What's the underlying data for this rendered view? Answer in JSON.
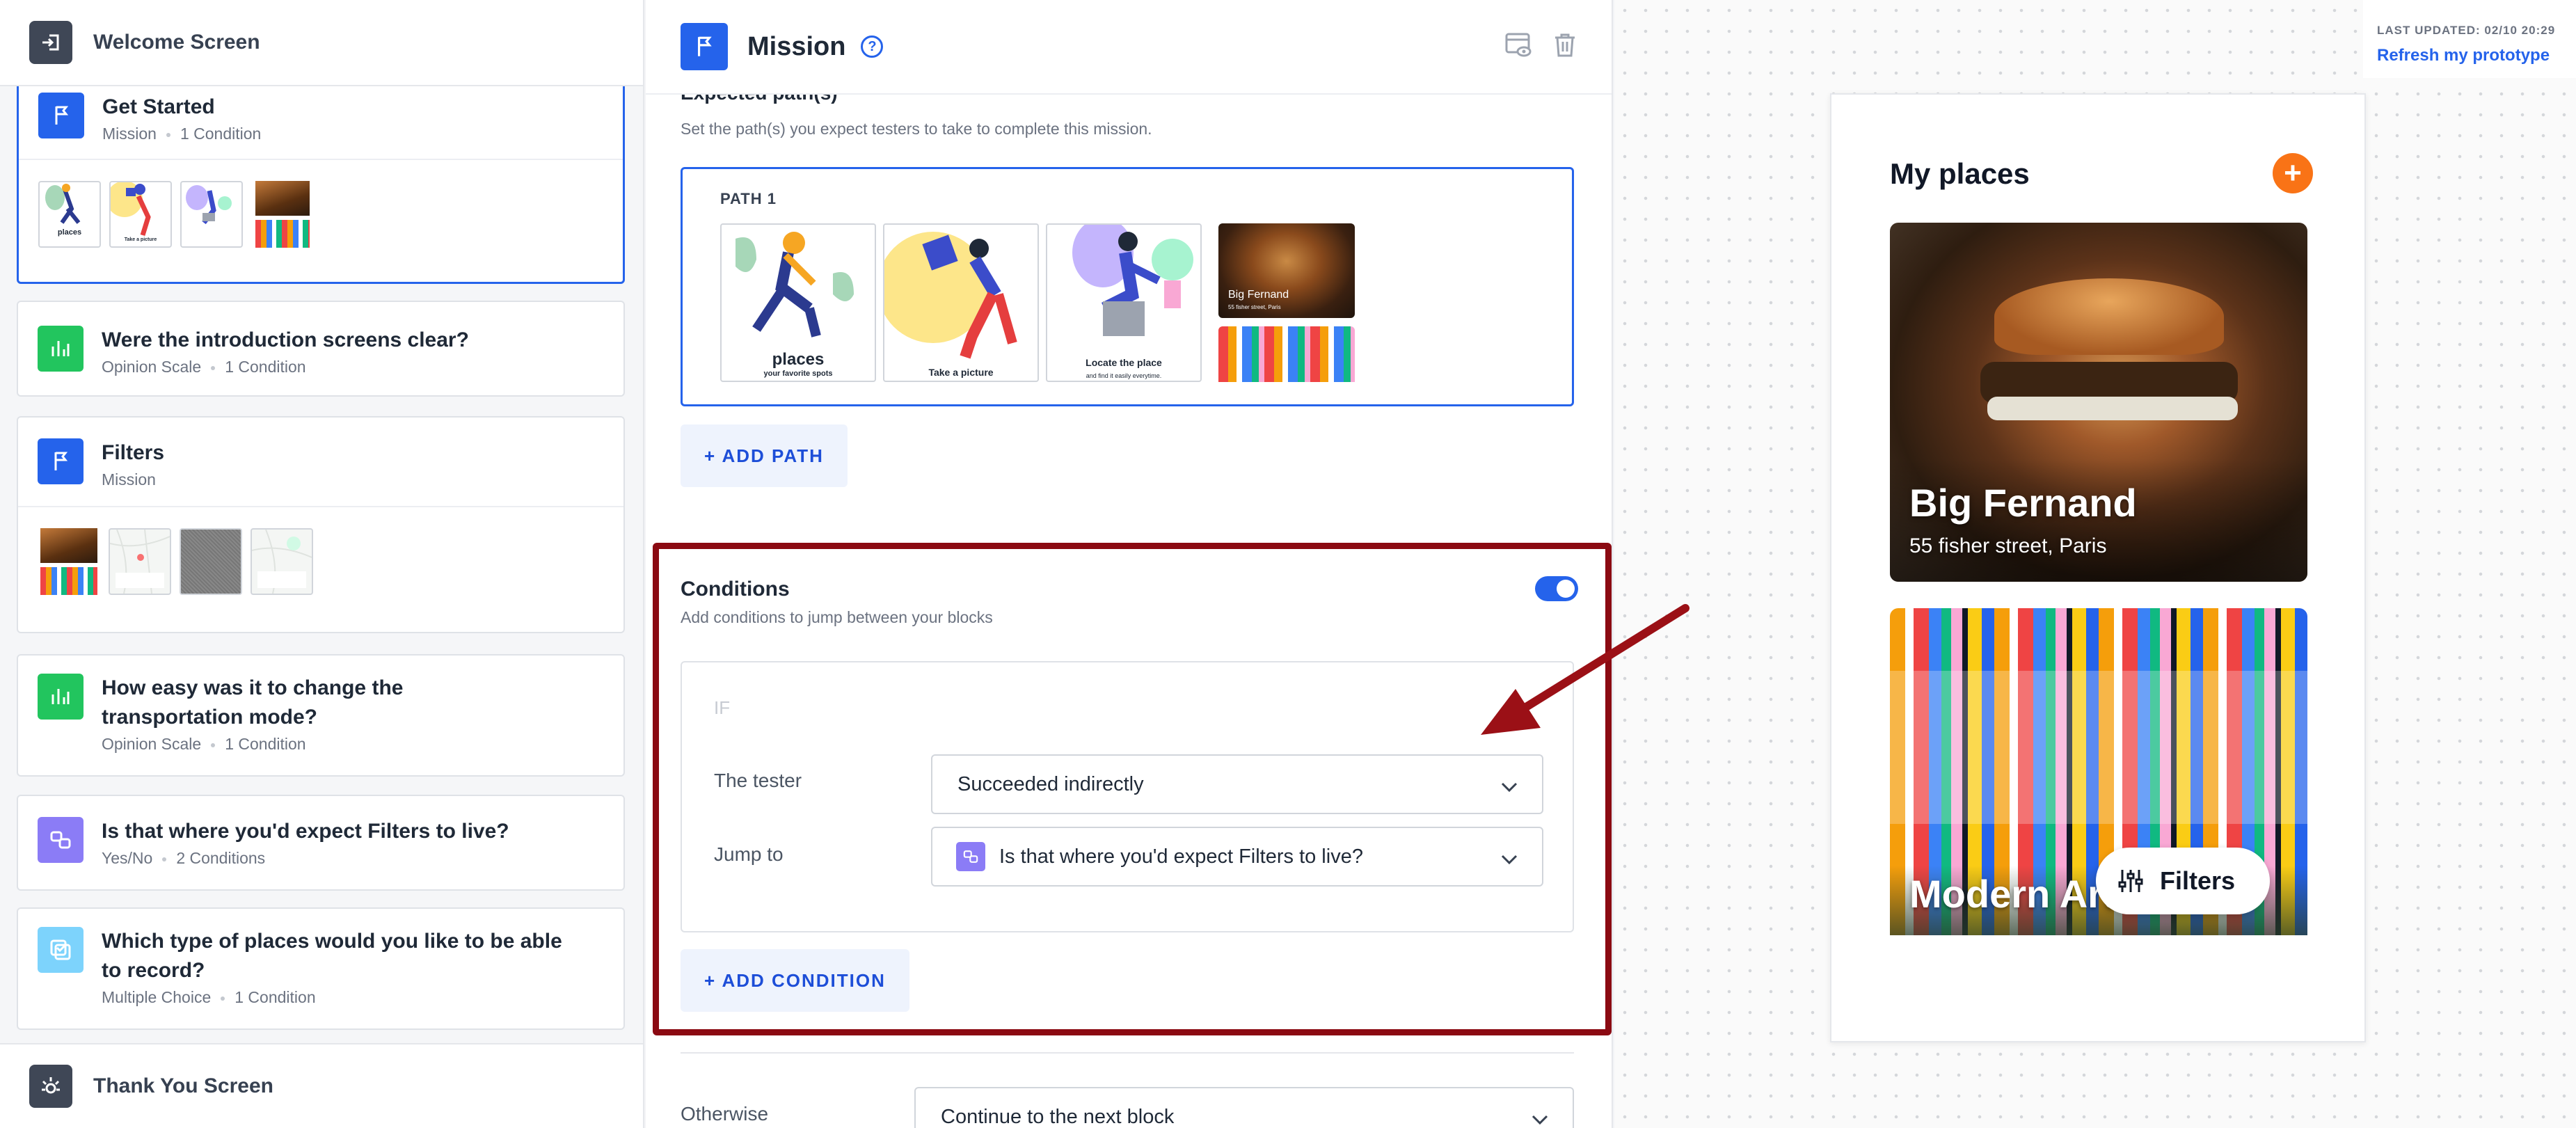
{
  "sidebar": {
    "welcome_label": "Welcome Screen",
    "thankyou_label": "Thank You Screen",
    "blocks": [
      {
        "title": "Get Started",
        "type": "Mission",
        "conditions": "1 Condition"
      },
      {
        "title": "Were the introduction screens clear?",
        "type": "Opinion Scale",
        "conditions": "1 Condition"
      },
      {
        "title": "Filters",
        "type": "Mission",
        "conditions": ""
      },
      {
        "title": "How easy was it to change the transportation mode?",
        "type": "Opinion Scale",
        "conditions": "1 Condition"
      },
      {
        "title": "Is that where you'd expect Filters to live?",
        "type": "Yes/No",
        "conditions": "2 Conditions"
      },
      {
        "title": "Which type of places would you like to be able to record?",
        "type": "Multiple Choice",
        "conditions": "1 Condition"
      }
    ],
    "thumb_texts": {
      "places": "places",
      "picture": "Take a picture"
    }
  },
  "editor": {
    "title": "Mission",
    "help_icon": "?",
    "expected_paths_label": "Expected path(s)",
    "expected_paths_sub": "Set the path(s) you expect testers to take to complete this mission.",
    "path_label": "PATH 1",
    "path_screens": {
      "s1_title": "places",
      "s1_sub": "your favorite spots",
      "s2_title": "Take a picture",
      "s3_title": "Locate the place",
      "s3_sub": "and find it easily everytime.",
      "s4_title": "Big Fernand",
      "s4_sub": "55 fisher street, Paris"
    },
    "add_path": "+ ADD PATH",
    "conditions_title": "Conditions",
    "conditions_sub": "Add conditions to jump between your blocks",
    "toggle_on": true,
    "if_label": "IF",
    "tester_label": "The tester",
    "tester_value": "Succeeded indirectly",
    "jump_label": "Jump to",
    "jump_value": "Is that where you'd expect Filters to live?",
    "add_condition": "+ ADD CONDITION",
    "otherwise_label": "Otherwise",
    "otherwise_value": "Continue to the next block"
  },
  "preview": {
    "last_updated": "LAST UPDATED: 02/10 20:29",
    "refresh": "Refresh my prototype",
    "title": "My places",
    "plus": "+",
    "card1_name": "Big Fernand",
    "card1_addr": "55 fisher street, Paris",
    "card2_name": "Modern Art M",
    "filters": "Filters"
  },
  "colors": {
    "accent": "#2563eb",
    "highlight_outline": "#8b0a12",
    "mission": "#2563eb",
    "opinion": "#22c55e",
    "yesno": "#8b7cf6",
    "choice": "#7dd3fc",
    "orange": "#f97316"
  }
}
